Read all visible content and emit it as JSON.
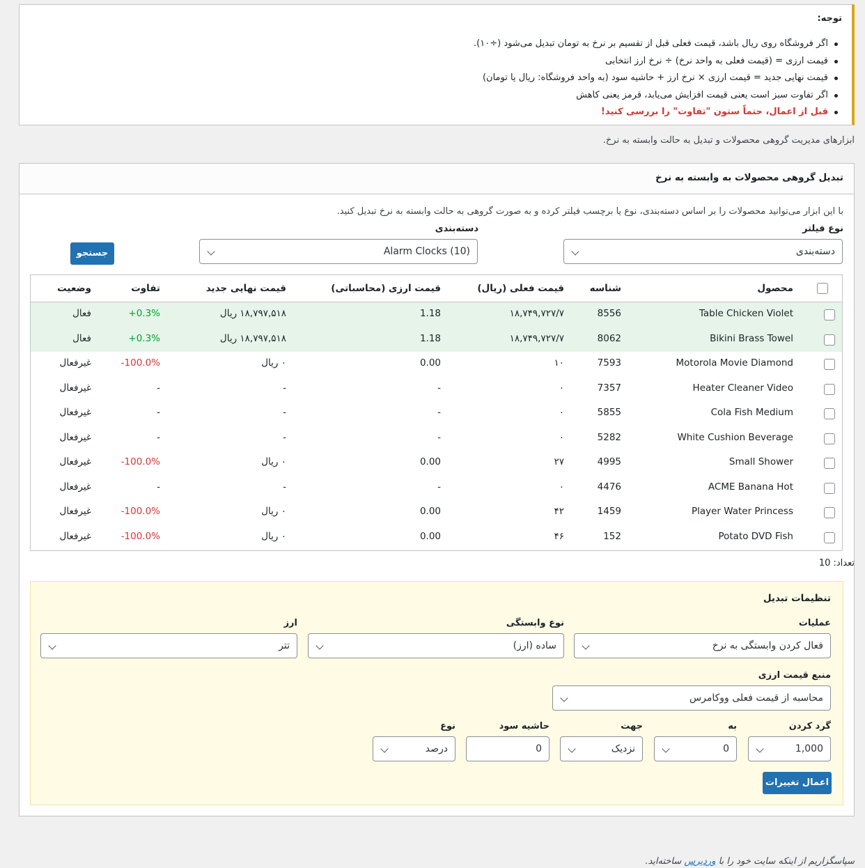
{
  "notice": {
    "title": "توجه:",
    "items": [
      "اگر فروشگاه روی ریال باشد، قیمت فعلی قبل از تقسیم بر نرخ به تومان تبدیل می‌شود (÷۱۰).",
      "قیمت ارزی = (قیمت فعلی به واحد نرخ) ÷ نرخ ارز انتخابی",
      "قیمت نهایی جدید = قیمت ارزی × نرخ ارز + حاشیه سود (به واحد فروشگاه: ریال یا تومان)",
      "اگر تفاوت سبز است یعنی قیمت افزایش می‌یابد، قرمز یعنی کاهش"
    ],
    "warning": "قبل از اعمال، حتماً ستون \"تفاوت\" را بررسی کنید!"
  },
  "page_description": "ابزارهای مدیریت گروهی محصولات و تبدیل به حالت وابسته به نرخ.",
  "card": {
    "title": "تبدیل گروهی محصولات به وابسته به نرخ",
    "intro": "با این ابزار می‌توانید محصولات را بر اساس دسته‌بندی، نوع یا برچسب فیلتر کرده و به صورت گروهی به حالت وابسته به نرخ تبدیل کنید."
  },
  "filter": {
    "type_label": "نوع فیلتر",
    "type_value": "دسته‌بندی",
    "category_label": "دسته‌بندی",
    "category_value": "Alarm Clocks (10)",
    "search_button": "جستجو"
  },
  "table": {
    "headers": {
      "product": "محصول",
      "id": "شناسه",
      "current_price": "قیمت فعلی (ریال)",
      "currency_price": "قیمت ارزی (محاسباتی)",
      "new_price": "قیمت نهایی جدید",
      "diff": "تفاوت",
      "status": "وضعیت"
    },
    "rows": [
      {
        "product": "Table Chicken Violet",
        "id": "8556",
        "current": "۱۸,۷۴۹,۷۲۷/۷",
        "currency": "1.18",
        "new": "۱۸,۷۹۷,۵۱۸ ریال",
        "diff": "+0.3%",
        "status": "فعال"
      },
      {
        "product": "Bikini Brass Towel",
        "id": "8062",
        "current": "۱۸,۷۴۹,۷۲۷/۷",
        "currency": "1.18",
        "new": "۱۸,۷۹۷,۵۱۸ ریال",
        "diff": "+0.3%",
        "status": "فعال"
      },
      {
        "product": "Motorola Movie Diamond",
        "id": "7593",
        "current": "۱۰",
        "currency": "0.00",
        "new": "۰ ریال",
        "diff": "-100.0%",
        "status": "غیرفعال"
      },
      {
        "product": "Heater Cleaner Video",
        "id": "7357",
        "current": "۰",
        "currency": "-",
        "new": "-",
        "diff": "-",
        "status": "غیرفعال"
      },
      {
        "product": "Cola Fish Medium",
        "id": "5855",
        "current": "۰",
        "currency": "-",
        "new": "-",
        "diff": "-",
        "status": "غیرفعال"
      },
      {
        "product": "White Cushion Beverage",
        "id": "5282",
        "current": "۰",
        "currency": "-",
        "new": "-",
        "diff": "-",
        "status": "غیرفعال"
      },
      {
        "product": "Small Shower",
        "id": "4995",
        "current": "۲۷",
        "currency": "0.00",
        "new": "۰ ریال",
        "diff": "-100.0%",
        "status": "غیرفعال"
      },
      {
        "product": "ACME Banana Hot",
        "id": "4476",
        "current": "۰",
        "currency": "-",
        "new": "-",
        "diff": "-",
        "status": "غیرفعال"
      },
      {
        "product": "Player Water Princess",
        "id": "1459",
        "current": "۴۲",
        "currency": "0.00",
        "new": "۰ ریال",
        "diff": "-100.0%",
        "status": "غیرفعال"
      },
      {
        "product": "Potato DVD Fish",
        "id": "152",
        "current": "۴۶",
        "currency": "0.00",
        "new": "۰ ریال",
        "diff": "-100.0%",
        "status": "غیرفعال"
      }
    ]
  },
  "count_text": "تعداد: 10",
  "settings": {
    "title": "تنظیمات تبدیل",
    "operation_label": "عملیات",
    "operation_value": "فعال کردن وابستگی به نرخ",
    "dependency_label": "نوع وابستگی",
    "dependency_value": "ساده (ارز)",
    "currency_label": "ارز",
    "currency_value": "تتر",
    "source_label": "منبع قیمت ارزی",
    "source_value": "محاسبه از قیمت فعلی ووکامرس",
    "round_label": "گرد کردن",
    "round_value": "1,000",
    "to_label": "به",
    "to_value": "0",
    "direction_label": "جهت",
    "direction_value": "نزدیک",
    "margin_label": "حاشیه سود",
    "margin_value": "0",
    "margin_type_label": "نوع",
    "margin_type_value": "درصد",
    "apply_button": "اعمال تغییرات"
  },
  "footer": {
    "text_before": "سپاسگزاریم از اینکه سایت خود را با",
    "link": "وردپرس",
    "text_after": "ساخته‌اید."
  },
  "colors": {
    "primary": "#2271b1",
    "positive": "#00a32a",
    "negative": "#d63638",
    "highlight_row": "#e6f4ea",
    "notice_border": "#dba617",
    "settings_bg": "#fffbe5"
  }
}
